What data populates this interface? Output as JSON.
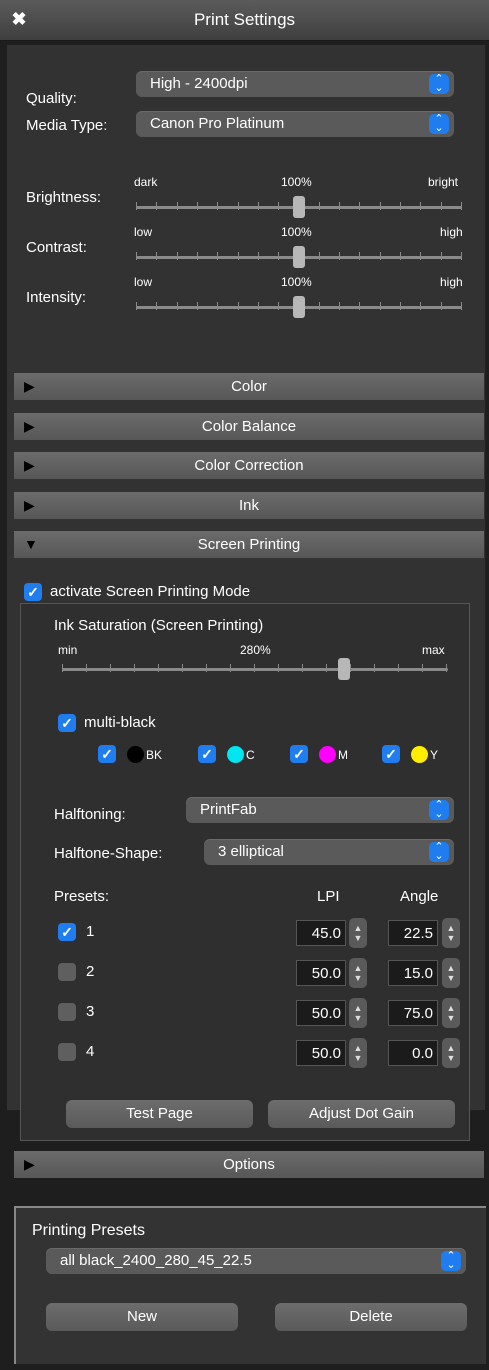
{
  "window": {
    "title": "Print Settings"
  },
  "quality": {
    "label": "Quality:",
    "value": "High - 2400dpi"
  },
  "media": {
    "label": "Media Type:",
    "value": "Canon Pro Platinum"
  },
  "sliders": [
    {
      "label": "Brightness:",
      "min": "dark",
      "mid": "100%",
      "max": "bright",
      "level": 0.5
    },
    {
      "label": "Contrast:",
      "min": "low",
      "mid": "100%",
      "max": "high",
      "level": 0.5
    },
    {
      "label": "Intensity:",
      "min": "low",
      "mid": "100%",
      "max": "high",
      "level": 0.5
    }
  ],
  "sections": {
    "color": "Color",
    "color_balance": "Color Balance",
    "color_correction": "Color Correction",
    "ink": "Ink",
    "screen_printing": "Screen Printing",
    "options": "Options"
  },
  "screen": {
    "activate_label": "activate Screen Printing Mode",
    "ink_sat_title": "Ink Saturation (Screen Printing)",
    "ink_sat_min": "min",
    "ink_sat_mid": "280%",
    "ink_sat_max": "max",
    "ink_sat_level": 0.73,
    "multiblack_label": "multi-black",
    "inks": [
      {
        "label": "BK",
        "color": "#000000"
      },
      {
        "label": "C",
        "color": "#00e5f0"
      },
      {
        "label": "M",
        "color": "#ff00ff"
      },
      {
        "label": "Y",
        "color": "#ffee00"
      }
    ],
    "halftoning_label": "Halftoning:",
    "halftoning_value": "PrintFab",
    "shape_label": "Halftone-Shape:",
    "shape_value": "3 elliptical",
    "presets_label": "Presets:",
    "lpi_label": "LPI",
    "angle_label": "Angle",
    "presets": [
      {
        "num": "1",
        "checked": true,
        "lpi": "45.0",
        "angle": "22.5"
      },
      {
        "num": "2",
        "checked": false,
        "lpi": "50.0",
        "angle": "15.0"
      },
      {
        "num": "3",
        "checked": false,
        "lpi": "50.0",
        "angle": "75.0"
      },
      {
        "num": "4",
        "checked": false,
        "lpi": "50.0",
        "angle": "0.0"
      }
    ],
    "test_page": "Test Page",
    "adjust_dot_gain": "Adjust Dot Gain"
  },
  "printing_presets": {
    "title": "Printing Presets",
    "value": "all black_2400_280_45_22.5",
    "new_label": "New",
    "delete_label": "Delete"
  },
  "colors": {
    "accent": "#1f7df0"
  }
}
